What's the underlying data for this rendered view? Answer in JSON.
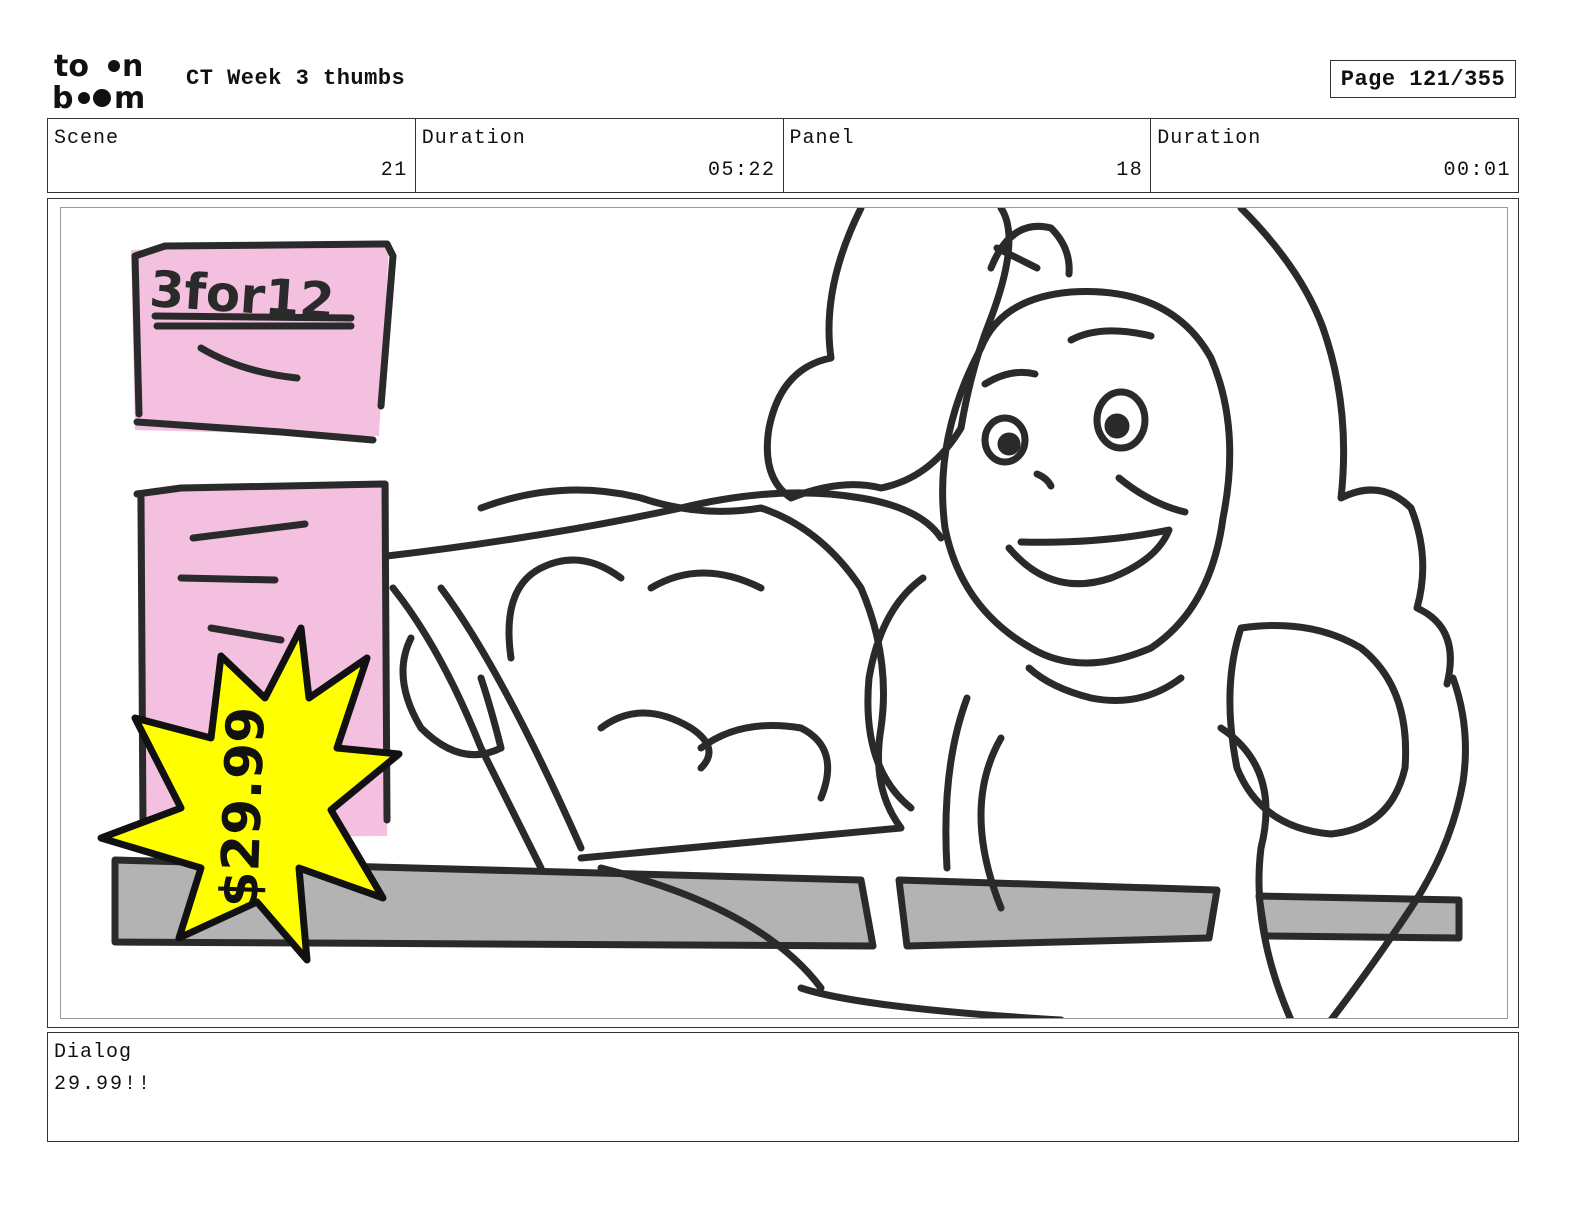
{
  "header": {
    "logo": {
      "top": "to",
      "top_end": "n",
      "bottom": "b",
      "bottom_end": "m"
    },
    "title": "CT Week 3 thumbs",
    "page": "Page 121/355"
  },
  "info": {
    "scene_label": "Scene",
    "scene_value": "21",
    "scene_duration_label": "Duration",
    "scene_duration_value": "05:22",
    "panel_label": "Panel",
    "panel_value": "18",
    "panel_duration_label": "Duration",
    "panel_duration_value": "00:01"
  },
  "panel": {
    "sign_text": "3for12",
    "price_text": "$29.99",
    "colors": {
      "sign_pink": "#f4c0e0",
      "starburst_yellow": "#ffff00",
      "counter_gray": "#b3b3b3",
      "ink": "#2a2a2a"
    }
  },
  "dialog": {
    "label": "Dialog",
    "text": "29.99!!"
  }
}
